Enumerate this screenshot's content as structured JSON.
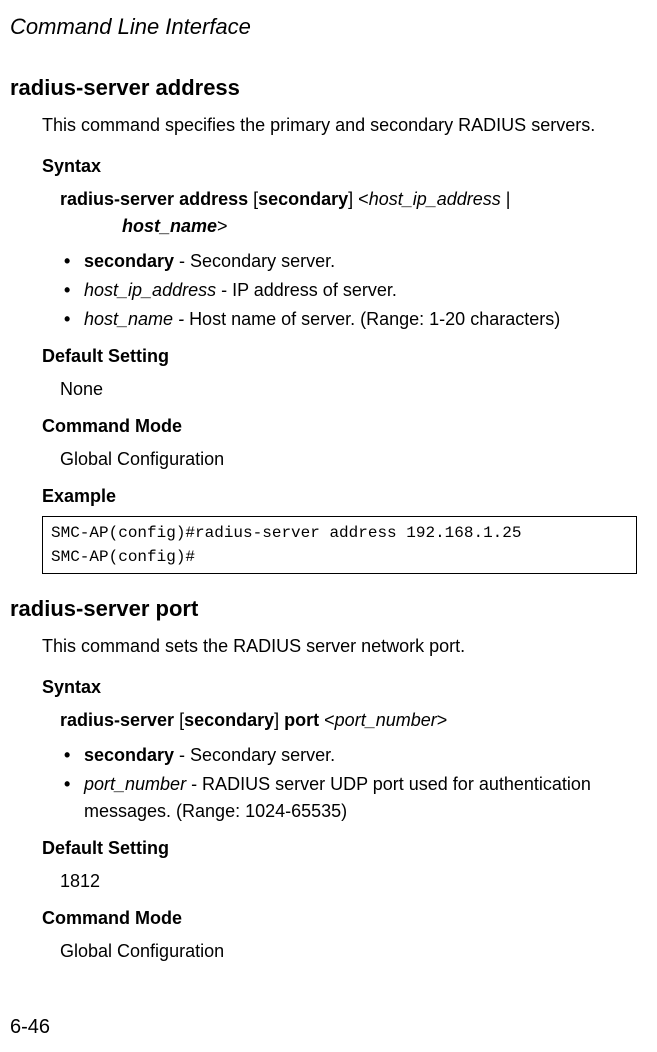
{
  "header": {
    "title": "Command Line Interface"
  },
  "section1": {
    "title": "radius-server address",
    "description": "This command specifies the primary and secondary RADIUS servers.",
    "syntax": {
      "heading": "Syntax",
      "line_part1": "radius-server address",
      "line_part2": " [",
      "line_part3": "secondary",
      "line_part4": "] <",
      "line_part5": "host_ip_address",
      "line_part6": " | ",
      "line_part7": "host_name",
      "line_part8": ">"
    },
    "params": {
      "p1_name": "secondary",
      "p1_desc": " - Secondary server.",
      "p2_name": "host_ip_address",
      "p2_desc": " - IP address of server.",
      "p3_name": "host_name",
      "p3_dash": " - ",
      "p3_desc": "Host name of server. (Range: 1-20 characters)"
    },
    "default": {
      "heading": "Default Setting",
      "value": "None"
    },
    "mode": {
      "heading": "Command Mode",
      "value": "Global Configuration"
    },
    "example": {
      "heading": "Example",
      "code": "SMC-AP(config)#radius-server address 192.168.1.25\nSMC-AP(config)#"
    }
  },
  "section2": {
    "title": "radius-server port",
    "description": "This command sets the RADIUS server network port.",
    "syntax": {
      "heading": "Syntax",
      "line_part1": "radius-server",
      "line_part2": " [",
      "line_part3": "secondary",
      "line_part4": "] ",
      "line_part5": "port",
      "line_part6": " <",
      "line_part7": "port_number",
      "line_part8": ">"
    },
    "params": {
      "p1_name": "secondary",
      "p1_desc": " - Secondary server.",
      "p2_name": "port_number",
      "p2_desc": " - RADIUS server UDP port used for authentication messages. (Range: 1024-65535)"
    },
    "default": {
      "heading": "Default Setting",
      "value": "1812"
    },
    "mode": {
      "heading": "Command Mode",
      "value": "Global Configuration"
    }
  },
  "footer": {
    "page": "6-46"
  }
}
